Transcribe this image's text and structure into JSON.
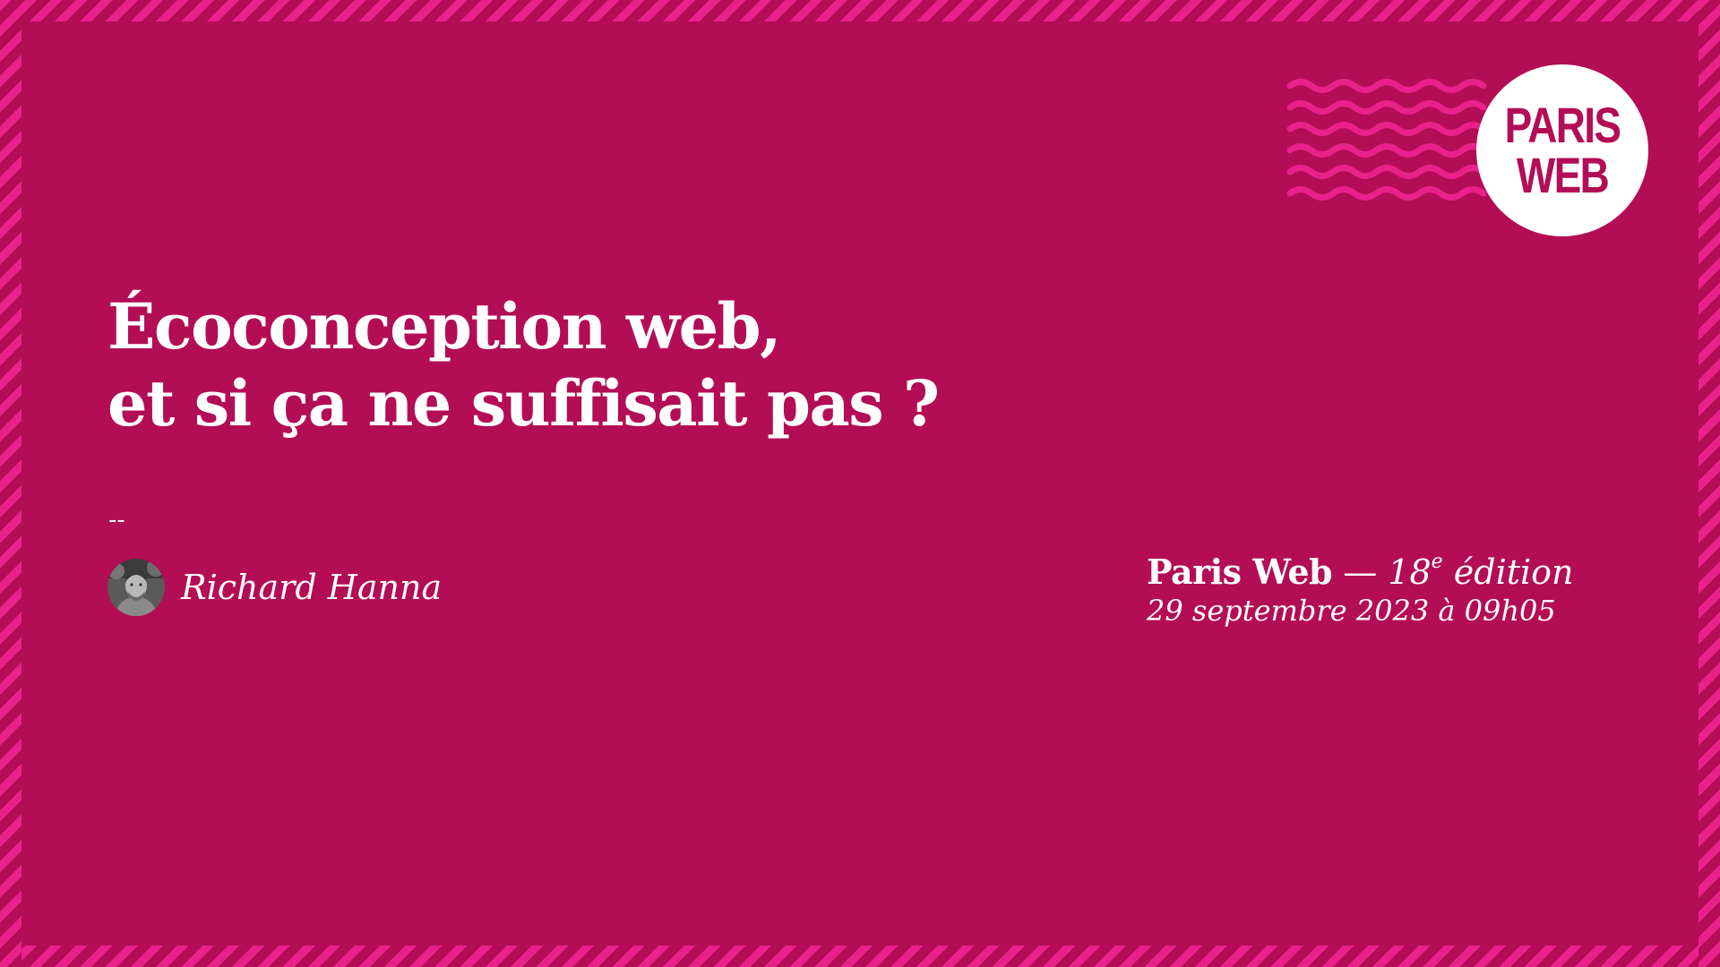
{
  "slide": {
    "background": "#b30d55",
    "accent": "#e8228a",
    "title_lines": [
      "Écoconception web,",
      "et si ça ne suffisait pas ?"
    ],
    "separator": "--",
    "speaker": {
      "name": "Richard Hanna",
      "avatar_icon": "speaker-photo"
    },
    "event": {
      "name": "Paris Web",
      "dash": "—",
      "edition_number": "18",
      "edition_sup": "e",
      "edition_word": "édition",
      "date": "29 septembre 2023 à 09h05"
    },
    "logo": {
      "line1": "PARIS",
      "line2": "WEB"
    }
  }
}
